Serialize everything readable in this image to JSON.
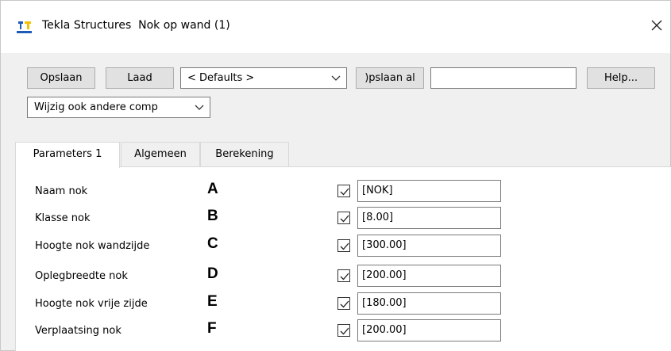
{
  "window": {
    "app_name": "Tekla Structures",
    "dialog_name": "Nok op wand (1)",
    "close_icon": "close-icon",
    "app_icon": "tekla-app-icon"
  },
  "toolbar": {
    "save_label": "Opslaan",
    "load_label": "Laad",
    "preset_value": "< Defaults >",
    "save_as_label": ")pslaan al",
    "save_as_name_value": "",
    "help_label": "Help...",
    "modify_value": "Wijzig ook andere comp"
  },
  "tabs": [
    {
      "label": "Parameters 1",
      "active": true
    },
    {
      "label": "Algemeen",
      "active": false
    },
    {
      "label": "Berekening",
      "active": false
    }
  ],
  "parameters": [
    {
      "label": "Naam nok",
      "letter": "A",
      "checked": true,
      "value": "[NOK]"
    },
    {
      "label": "Klasse nok",
      "letter": "B",
      "checked": true,
      "value": "[8.00]"
    },
    {
      "label": "Hoogte nok wandzijde",
      "letter": "C",
      "checked": true,
      "value": "[300.00]"
    },
    {
      "label": "Oplegbreedte nok",
      "letter": "D",
      "checked": true,
      "value": "[200.00]"
    },
    {
      "label": "Hoogte nok vrije zijde",
      "letter": "E",
      "checked": true,
      "value": "[180.00]"
    },
    {
      "label": "Verplaatsing nok",
      "letter": "F",
      "checked": true,
      "value": "[200.00]"
    }
  ],
  "colors": {
    "window_bg": "#f0f0f0",
    "panel_bg": "#ffffff",
    "focus_border": "#0078d7",
    "icon_blue": "#1e5bb8",
    "icon_yellow": "#f2c200"
  }
}
